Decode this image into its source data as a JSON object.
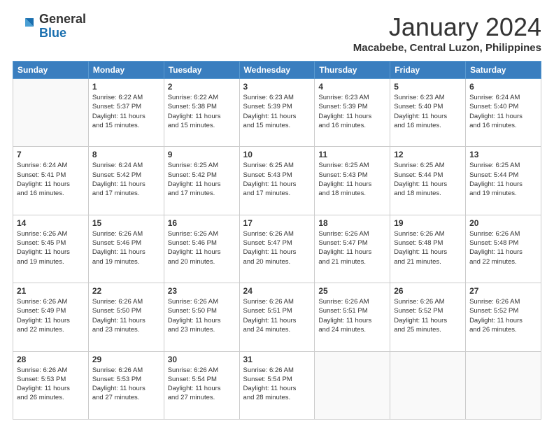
{
  "logo": {
    "general": "General",
    "blue": "Blue"
  },
  "header": {
    "month": "January 2024",
    "location": "Macabebe, Central Luzon, Philippines"
  },
  "weekdays": [
    "Sunday",
    "Monday",
    "Tuesday",
    "Wednesday",
    "Thursday",
    "Friday",
    "Saturday"
  ],
  "weeks": [
    [
      {
        "day": "",
        "info": ""
      },
      {
        "day": "1",
        "info": "Sunrise: 6:22 AM\nSunset: 5:37 PM\nDaylight: 11 hours\nand 15 minutes."
      },
      {
        "day": "2",
        "info": "Sunrise: 6:22 AM\nSunset: 5:38 PM\nDaylight: 11 hours\nand 15 minutes."
      },
      {
        "day": "3",
        "info": "Sunrise: 6:23 AM\nSunset: 5:39 PM\nDaylight: 11 hours\nand 15 minutes."
      },
      {
        "day": "4",
        "info": "Sunrise: 6:23 AM\nSunset: 5:39 PM\nDaylight: 11 hours\nand 16 minutes."
      },
      {
        "day": "5",
        "info": "Sunrise: 6:23 AM\nSunset: 5:40 PM\nDaylight: 11 hours\nand 16 minutes."
      },
      {
        "day": "6",
        "info": "Sunrise: 6:24 AM\nSunset: 5:40 PM\nDaylight: 11 hours\nand 16 minutes."
      }
    ],
    [
      {
        "day": "7",
        "info": "Sunrise: 6:24 AM\nSunset: 5:41 PM\nDaylight: 11 hours\nand 16 minutes."
      },
      {
        "day": "8",
        "info": "Sunrise: 6:24 AM\nSunset: 5:42 PM\nDaylight: 11 hours\nand 17 minutes."
      },
      {
        "day": "9",
        "info": "Sunrise: 6:25 AM\nSunset: 5:42 PM\nDaylight: 11 hours\nand 17 minutes."
      },
      {
        "day": "10",
        "info": "Sunrise: 6:25 AM\nSunset: 5:43 PM\nDaylight: 11 hours\nand 17 minutes."
      },
      {
        "day": "11",
        "info": "Sunrise: 6:25 AM\nSunset: 5:43 PM\nDaylight: 11 hours\nand 18 minutes."
      },
      {
        "day": "12",
        "info": "Sunrise: 6:25 AM\nSunset: 5:44 PM\nDaylight: 11 hours\nand 18 minutes."
      },
      {
        "day": "13",
        "info": "Sunrise: 6:25 AM\nSunset: 5:44 PM\nDaylight: 11 hours\nand 19 minutes."
      }
    ],
    [
      {
        "day": "14",
        "info": "Sunrise: 6:26 AM\nSunset: 5:45 PM\nDaylight: 11 hours\nand 19 minutes."
      },
      {
        "day": "15",
        "info": "Sunrise: 6:26 AM\nSunset: 5:46 PM\nDaylight: 11 hours\nand 19 minutes."
      },
      {
        "day": "16",
        "info": "Sunrise: 6:26 AM\nSunset: 5:46 PM\nDaylight: 11 hours\nand 20 minutes."
      },
      {
        "day": "17",
        "info": "Sunrise: 6:26 AM\nSunset: 5:47 PM\nDaylight: 11 hours\nand 20 minutes."
      },
      {
        "day": "18",
        "info": "Sunrise: 6:26 AM\nSunset: 5:47 PM\nDaylight: 11 hours\nand 21 minutes."
      },
      {
        "day": "19",
        "info": "Sunrise: 6:26 AM\nSunset: 5:48 PM\nDaylight: 11 hours\nand 21 minutes."
      },
      {
        "day": "20",
        "info": "Sunrise: 6:26 AM\nSunset: 5:48 PM\nDaylight: 11 hours\nand 22 minutes."
      }
    ],
    [
      {
        "day": "21",
        "info": "Sunrise: 6:26 AM\nSunset: 5:49 PM\nDaylight: 11 hours\nand 22 minutes."
      },
      {
        "day": "22",
        "info": "Sunrise: 6:26 AM\nSunset: 5:50 PM\nDaylight: 11 hours\nand 23 minutes."
      },
      {
        "day": "23",
        "info": "Sunrise: 6:26 AM\nSunset: 5:50 PM\nDaylight: 11 hours\nand 23 minutes."
      },
      {
        "day": "24",
        "info": "Sunrise: 6:26 AM\nSunset: 5:51 PM\nDaylight: 11 hours\nand 24 minutes."
      },
      {
        "day": "25",
        "info": "Sunrise: 6:26 AM\nSunset: 5:51 PM\nDaylight: 11 hours\nand 24 minutes."
      },
      {
        "day": "26",
        "info": "Sunrise: 6:26 AM\nSunset: 5:52 PM\nDaylight: 11 hours\nand 25 minutes."
      },
      {
        "day": "27",
        "info": "Sunrise: 6:26 AM\nSunset: 5:52 PM\nDaylight: 11 hours\nand 26 minutes."
      }
    ],
    [
      {
        "day": "28",
        "info": "Sunrise: 6:26 AM\nSunset: 5:53 PM\nDaylight: 11 hours\nand 26 minutes."
      },
      {
        "day": "29",
        "info": "Sunrise: 6:26 AM\nSunset: 5:53 PM\nDaylight: 11 hours\nand 27 minutes."
      },
      {
        "day": "30",
        "info": "Sunrise: 6:26 AM\nSunset: 5:54 PM\nDaylight: 11 hours\nand 27 minutes."
      },
      {
        "day": "31",
        "info": "Sunrise: 6:26 AM\nSunset: 5:54 PM\nDaylight: 11 hours\nand 28 minutes."
      },
      {
        "day": "",
        "info": ""
      },
      {
        "day": "",
        "info": ""
      },
      {
        "day": "",
        "info": ""
      }
    ]
  ]
}
